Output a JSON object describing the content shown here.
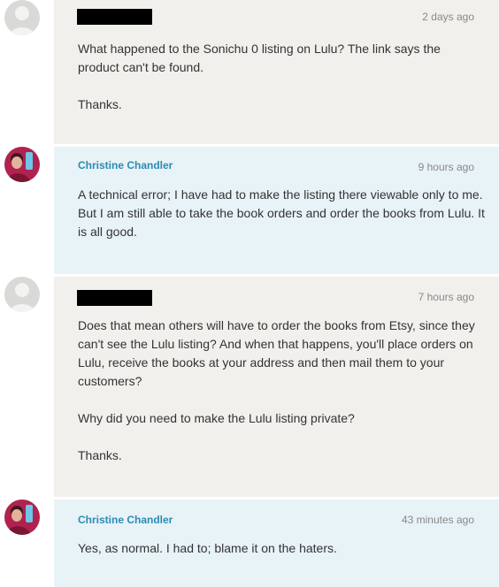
{
  "messages": [
    {
      "author": "",
      "author_redacted": true,
      "time": "2 days ago",
      "paragraphs": [
        "What happened to the Sonichu 0 listing on Lulu? The link says the product can't be found.",
        "Thanks."
      ]
    },
    {
      "author": "Christine Chandler",
      "author_redacted": false,
      "time": "9 hours ago",
      "paragraphs": [
        "A technical error; I have had to make the listing there viewable only to me. But I am still able to take the book orders and order the books from Lulu. It is all good."
      ]
    },
    {
      "author": "",
      "author_redacted": true,
      "time": "7 hours ago",
      "paragraphs": [
        "Does that mean others will have to order the books from Etsy, since they can't see the Lulu listing? And when that happens, you'll place orders on Lulu, receive the books at your address and then mail them to your customers?",
        "Why did you need to make the Lulu listing private?",
        "Thanks."
      ]
    },
    {
      "author": "Christine Chandler",
      "author_redacted": false,
      "time": "43 minutes ago",
      "paragraphs": [
        "Yes, as normal. I had to; blame it on the haters."
      ]
    }
  ],
  "colors": {
    "gray_bubble": "#f1f0ec",
    "blue_bubble": "#e8f3f7",
    "author_link": "#2b8bb3",
    "timestamp": "#888888",
    "body_text": "#333333"
  },
  "icons": {
    "default_avatar": "default-user-avatar-icon",
    "user_avatar": "user-photo-avatar"
  }
}
